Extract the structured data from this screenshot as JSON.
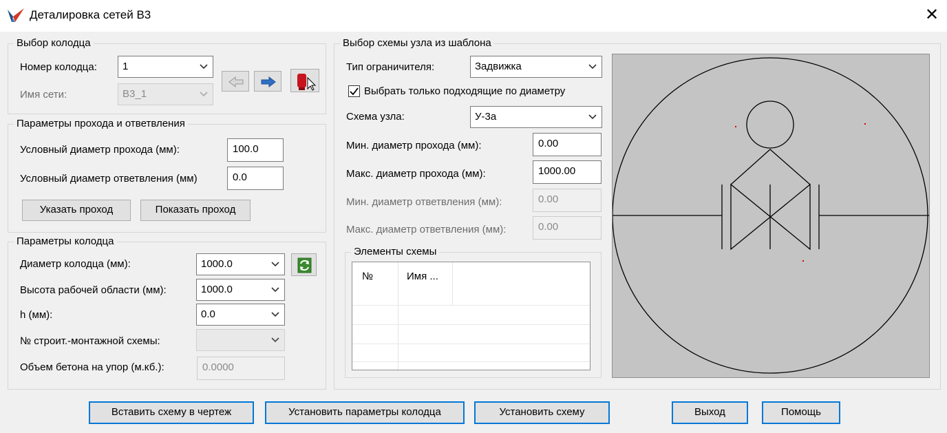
{
  "window": {
    "title": "Деталировка сетей В3",
    "close_glyph": "✕"
  },
  "well_select": {
    "title": "Выбор колодца",
    "well_number_label": "Номер колодца:",
    "well_number_value": "1",
    "network_name_label": "Имя сети:",
    "network_name_value": "В3_1"
  },
  "pass_params": {
    "title": "Параметры прохода и ответвления",
    "pass_diameter_label": "Условный диаметр прохода (мм):",
    "pass_diameter_value": "100.0",
    "branch_diameter_label": "Условный диаметр ответвления (мм)",
    "branch_diameter_value": "0.0",
    "specify_pass_button": "Указать проход",
    "show_pass_button": "Показать проход"
  },
  "well_params": {
    "title": "Параметры колодца",
    "diameter_label": "Диаметр колодца (мм):",
    "diameter_value": "1000.0",
    "work_height_label": "Высота рабочей области (мм):",
    "work_height_value": "1000.0",
    "h_label": "h (мм):",
    "h_value": "0.0",
    "scheme_no_label": "№ строит.-монтажной схемы:",
    "scheme_no_value": "",
    "concrete_label": "Объем бетона на упор (м.кб.):",
    "concrete_value": "0.0000"
  },
  "template": {
    "title": "Выбор схемы узла из шаблона",
    "limiter_type_label": "Тип ограничителя:",
    "limiter_type_value": "Задвижка",
    "only_matching_label": "Выбрать только подходящие по диаметру",
    "only_matching_checked": true,
    "node_scheme_label": "Схема узла:",
    "node_scheme_value": "У-3а",
    "min_pass_label": "Мин. диаметр прохода (мм):",
    "min_pass_value": "0.00",
    "max_pass_label": "Макс. диаметр прохода (мм):",
    "max_pass_value": "1000.00",
    "min_branch_label": "Мин. диаметр ответвления (мм):",
    "min_branch_value": "0.00",
    "max_branch_label": "Макс. диаметр ответвления (мм):",
    "max_branch_value": "0.00",
    "elements_title": "Элементы схемы",
    "elements_columns": [
      "№",
      "Имя ..."
    ]
  },
  "footer": {
    "insert_button": "Вставить схему в чертеж",
    "set_params_button": "Установить параметры колодца",
    "set_scheme_button": "Установить схему",
    "exit_button": "Выход",
    "help_button": "Помощь"
  },
  "icons": {
    "app": "app-logo-icon",
    "prev": "arrow-left-icon",
    "next": "arrow-right-icon",
    "pick": "pick-well-icon",
    "refresh": "refresh-icon",
    "dropdown": "chevron-down-icon",
    "check": "checkmark-icon"
  },
  "colors": {
    "accent": "#0078d7",
    "preview_bg": "#c4c4c4",
    "arrow_blue": "#2f6fc4",
    "pick_red": "#c8141e"
  }
}
